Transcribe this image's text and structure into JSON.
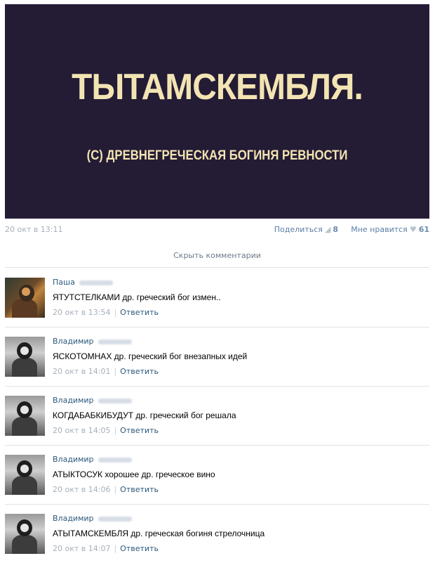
{
  "post": {
    "image_title": "ТЫТАМСКЕМБЛЯ.",
    "image_caption": "(С) ДРЕВНЕГРЕЧЕСКАЯ БОГИНЯ РЕВНОСТИ",
    "date": "20 окт в 13:11",
    "share_label": "Поделиться",
    "share_count": "8",
    "like_label": "Мне нравится",
    "like_count": "61"
  },
  "comments_toggle": "Скрыть комментарии",
  "reply_label": "Ответить",
  "comments": [
    {
      "author": "Паша",
      "text": "ЯТУТСТЕЛКАМИ др. греческий бог измен..",
      "time": "20 окт в 13:54"
    },
    {
      "author": "Владимир",
      "text": "ЯСКОТОМНАХ др. греческий бог внезапных идей",
      "time": "20 окт в 14:01"
    },
    {
      "author": "Владимир",
      "text": "КОГДАБАБКИБУДУТ др. греческий бог решала",
      "time": "20 окт в 14:05"
    },
    {
      "author": "Владимир",
      "text": "АТЫКТОСУК хорошее др. греческое вино",
      "time": "20 окт в 14:06"
    },
    {
      "author": "Владимир",
      "text": "АТЫТАМСКЕМБЛЯ др. греческая богиня стрелочница",
      "time": "20 окт в 14:07"
    }
  ],
  "colors": {
    "image_bg": "#241c35",
    "image_text": "#f3e4b3",
    "link": "#2b587a",
    "muted": "#a7b0bb"
  },
  "icons": {
    "share": "megaphone-icon",
    "like": "heart-icon"
  }
}
